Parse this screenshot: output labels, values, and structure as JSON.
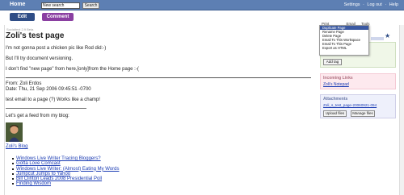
{
  "topbar": {
    "home": "Home",
    "search_value": "New search",
    "search_button": "Search",
    "settings": "Settings",
    "logout": "Log out",
    "help": "Help"
  },
  "actions": {
    "edit": "Edit",
    "comment": "Comment"
  },
  "page": {
    "breadcrumb": "Socialtext 2.9 Beta",
    "title": "Zoli's test page",
    "paragraphs": [
      "I'm not gonna post a chicken pic like Rod did:-)",
      "But I'll try document versioning.",
      "I don't find \"new page\" from here,[only]from the Home page :-("
    ],
    "email_from": "From: Zoli Erdos",
    "email_date": "Date: Thu, 21 Sep 2006 09:45:51 -0700",
    "email_text": "test email to a page (?) Works like a champ!",
    "feed_intro": "Let's get a feed from my blog:",
    "blog_link": "Zoli's Blog",
    "blog_posts": [
      "Windows Live Writer Tracing Bloggers?",
      "Gotta Love Comcast",
      "Windows Live Writer: (Almost) Eating My Words",
      "Jumpcut Jumps to Yahoo",
      "Bill Clinton Leads 2008 Presidential Poll",
      "Finding Wisdom"
    ]
  },
  "toolbar": {
    "print": "Print",
    "email": "Email",
    "tools": "Tools"
  },
  "tools_menu": [
    "Duplicate Page",
    "Rename Page",
    "Delete Page",
    "Email To This Workspace",
    "Email To This Page",
    "Export as HTML"
  ],
  "sidebar": {
    "tags_title": "Tags",
    "add_tag": "Add tag",
    "incoming_title": "Incoming Links",
    "incoming_link": "Zoli's Notepad",
    "attachments_title": "Attachments",
    "attachment_file": "Zoli_s_test_page-20060921-094",
    "upload": "Upload files",
    "manage": "Manage files"
  }
}
